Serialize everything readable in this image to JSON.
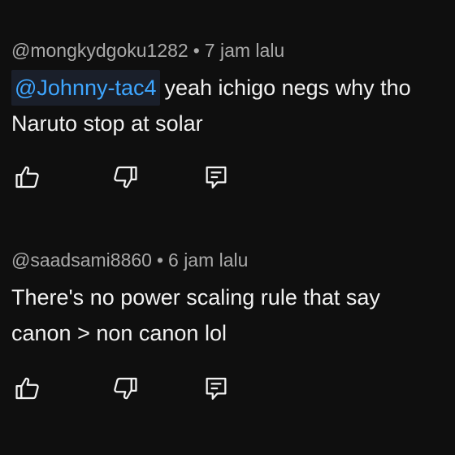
{
  "comments": [
    {
      "author": "@mongkydgoku1282",
      "separator": "•",
      "time": "7 jam lalu",
      "mention": "@Johnny-tac4",
      "line1_text": "yeah ichigo negs why tho",
      "line2_text": "Naruto stop at solar",
      "actions": {
        "like_icon": "thumbs-up-icon",
        "dislike_icon": "thumbs-down-icon",
        "reply_icon": "reply-comment-icon"
      }
    },
    {
      "author": "@saadsami8860",
      "separator": "•",
      "time": "6 jam lalu",
      "line1_text": "There's no power scaling rule that say",
      "line2_text": "canon > non canon lol",
      "actions": {
        "like_icon": "thumbs-up-icon",
        "dislike_icon": "thumbs-down-icon",
        "reply_icon": "reply-comment-icon"
      }
    }
  ],
  "colors": {
    "background": "#0f0f0f",
    "text": "#f1f1f1",
    "meta": "#aaaaaa",
    "mention": "#3ea6ff"
  }
}
